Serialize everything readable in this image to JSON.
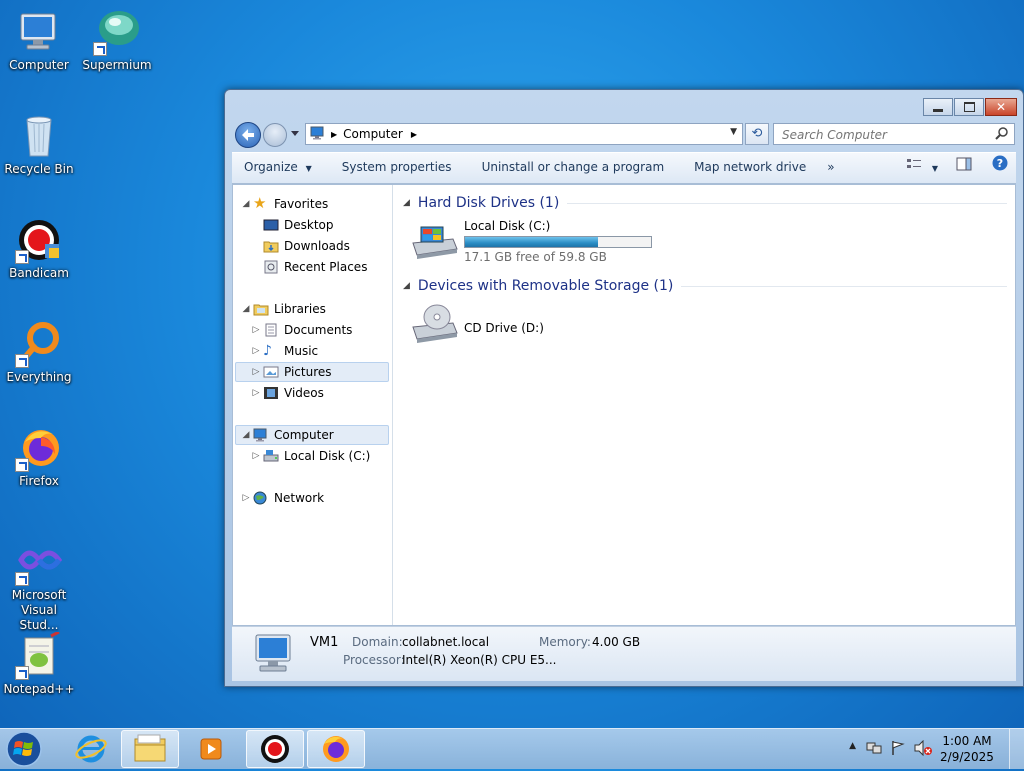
{
  "desktop": {
    "icons": [
      {
        "label": "Computer"
      },
      {
        "label": "Supermium"
      },
      {
        "label": "Recycle Bin"
      },
      {
        "label": "Bandicam"
      },
      {
        "label": "Everything"
      },
      {
        "label": "Firefox"
      },
      {
        "label": "Microsoft Visual Stud..."
      },
      {
        "label": "Notepad++"
      }
    ]
  },
  "window": {
    "address": {
      "path": [
        "Computer"
      ]
    },
    "search": {
      "placeholder": "Search Computer"
    },
    "toolbar": {
      "organize": "Organize",
      "system_properties": "System properties",
      "uninstall": "Uninstall or change a program",
      "map_drive": "Map network drive",
      "more": "»"
    },
    "nav": {
      "favorites": "Favorites",
      "desktop": "Desktop",
      "downloads": "Downloads",
      "recent_places": "Recent Places",
      "libraries": "Libraries",
      "documents": "Documents",
      "music": "Music",
      "pictures": "Pictures",
      "videos": "Videos",
      "computer": "Computer",
      "local_disk": "Local Disk (C:)",
      "network": "Network"
    },
    "groups": {
      "hard_disk": "Hard Disk Drives (1)",
      "removable": "Devices with Removable Storage (1)"
    },
    "drives": {
      "c": {
        "name": "Local Disk (C:)",
        "free_text": "17.1 GB free of 59.8 GB",
        "used_fraction": 0.714
      },
      "d": {
        "name": "CD Drive (D:)"
      }
    },
    "details": {
      "name": "VM1",
      "domain_label": "Domain:",
      "domain_value": "collabnet.local",
      "memory_label": "Memory:",
      "memory_value": "4.00 GB",
      "processor_label": "Processor:",
      "processor_value": "Intel(R) Xeon(R) CPU E5..."
    }
  },
  "taskbar": {
    "time": "1:00 AM",
    "date": "2/9/2025"
  },
  "colors": {
    "accent": "#1e3287",
    "progress": "#2a8dc4"
  }
}
